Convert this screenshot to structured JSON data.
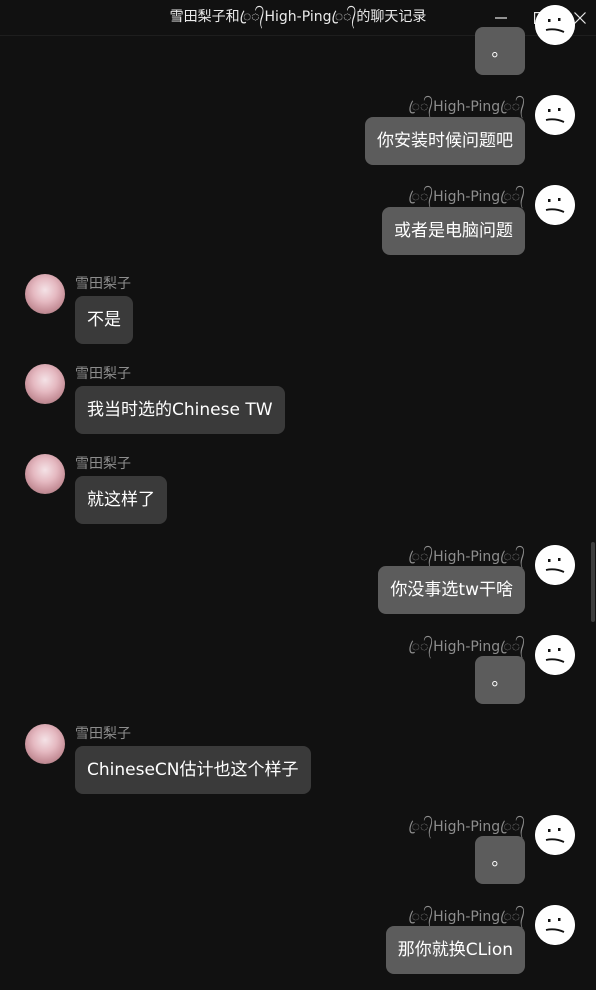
{
  "window": {
    "title": "雪田梨子和ꦿ᭄High-Pingꦿ᭄的聊天记录"
  },
  "contacts": {
    "left_name": "雪田梨子",
    "right_name": "ꦿ᭄High-Pingꦿ᭄"
  },
  "messages": [
    {
      "side": "right",
      "show_name": false,
      "text": "。"
    },
    {
      "side": "right",
      "show_name": true,
      "name": "ꦿ᭄High-Pingꦿ᭄",
      "text": "你安装时候问题吧"
    },
    {
      "side": "right",
      "show_name": true,
      "name": "ꦿ᭄High-Pingꦿ᭄",
      "text": "或者是电脑问题"
    },
    {
      "side": "left",
      "show_name": true,
      "name": "雪田梨子",
      "text": "不是"
    },
    {
      "side": "left",
      "show_name": true,
      "name": "雪田梨子",
      "text": "我当时选的Chinese TW"
    },
    {
      "side": "left",
      "show_name": true,
      "name": "雪田梨子",
      "text": "就这样了"
    },
    {
      "side": "right",
      "show_name": true,
      "name": "ꦿ᭄High-Pingꦿ᭄",
      "text": "你没事选tw干啥"
    },
    {
      "side": "right",
      "show_name": true,
      "name": "ꦿ᭄High-Pingꦿ᭄",
      "text": "。"
    },
    {
      "side": "left",
      "show_name": true,
      "name": "雪田梨子",
      "text": "ChineseCN估计也这个样子"
    },
    {
      "side": "right",
      "show_name": true,
      "name": "ꦿ᭄High-Pingꦿ᭄",
      "text": "。"
    },
    {
      "side": "right",
      "show_name": true,
      "name": "ꦿ᭄High-Pingꦿ᭄",
      "text": "那你就换CLion"
    }
  ],
  "icons": {
    "minimize": "minimize-icon",
    "maximize": "maximize-icon",
    "close": "close-icon",
    "left_avatar": "avatar-photo",
    "right_avatar": "avatar-face"
  }
}
